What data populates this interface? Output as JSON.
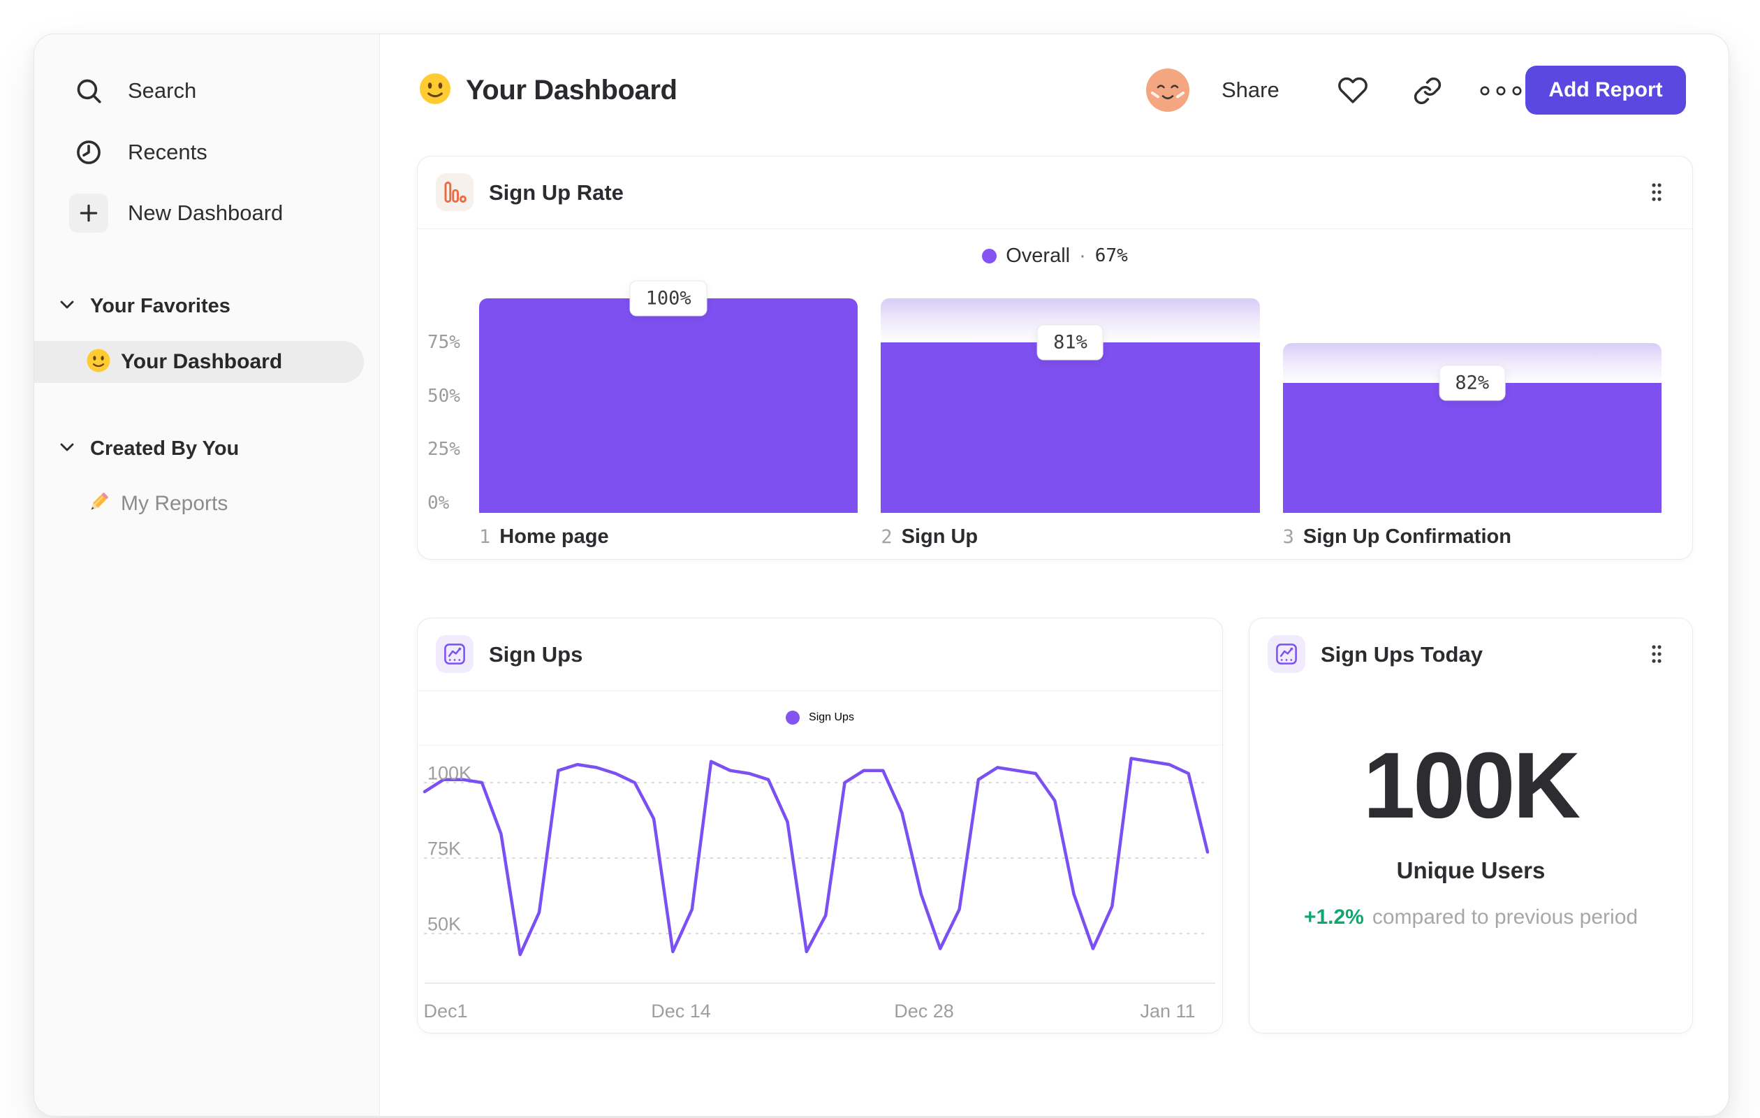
{
  "header": {
    "title": "Your Dashboard",
    "share_label": "Share",
    "add_report_label": "Add Report"
  },
  "sidebar": {
    "nav": [
      {
        "label": "Search",
        "icon": "search-icon"
      },
      {
        "label": "Recents",
        "icon": "clock-icon"
      },
      {
        "label": "New Dashboard",
        "icon": "plus-icon"
      }
    ],
    "sections": [
      {
        "title": "Your Favorites",
        "items": [
          {
            "label": "Your Dashboard",
            "icon": "smiley-emoji",
            "selected": true
          }
        ]
      },
      {
        "title": "Created By You",
        "items": [
          {
            "label": "My Reports",
            "icon": "pencil-emoji",
            "selected": false
          }
        ]
      }
    ]
  },
  "colors": {
    "accent_purple": "#7E50F0",
    "accent_indigo": "#5B48E0",
    "fade_gradient_top": "#D8CCF8",
    "positive_green": "#14A56F",
    "funnel_icon_orange": "#EE6A40",
    "sidebar_bg": "#FAFAFA"
  },
  "chart_data": [
    {
      "type": "bar",
      "subtype": "funnel-conversion",
      "title": "Sign Up Rate",
      "legend": {
        "series": "Overall",
        "separator": "·",
        "overall_value": "67%",
        "position": "top-center"
      },
      "ylim": [
        0,
        100
      ],
      "y_ticks": [
        "75%",
        "50%",
        "25%",
        "0%"
      ],
      "grid": false,
      "bar_color": "#7E50F0",
      "steps": [
        {
          "index": "1",
          "name": "Home page",
          "conversion_label": "100%",
          "bar_top_pct": 100,
          "solid_pct": 100
        },
        {
          "index": "2",
          "name": "Sign Up",
          "conversion_label": "81%",
          "bar_top_pct": 100,
          "solid_pct": 79.5
        },
        {
          "index": "3",
          "name": "Sign Up Confirmation",
          "conversion_label": "82%",
          "bar_top_pct": 79,
          "solid_pct": 60.5
        }
      ]
    },
    {
      "type": "line",
      "title": "Sign Ups",
      "legend": {
        "series": "Sign Ups",
        "position": "top-center"
      },
      "x_ticks": [
        "Dec1",
        "Dec 14",
        "Dec 28",
        "Jan 11"
      ],
      "y_ticks": [
        "100K",
        "75K",
        "50K"
      ],
      "unit": "K users",
      "grid": "dotted-horizontal",
      "line_color": "#7B50F2",
      "values_k": [
        97,
        101,
        101,
        100,
        83,
        43,
        57,
        104,
        106,
        105,
        103,
        100,
        88,
        44,
        58,
        107,
        104,
        103,
        101,
        87,
        44,
        56,
        100,
        104,
        104,
        90,
        63,
        45,
        58,
        101,
        105,
        104,
        103,
        94,
        63,
        45,
        59,
        108,
        107,
        106,
        103,
        77
      ]
    },
    {
      "type": "metric",
      "title": "Sign Ups Today",
      "value": "100K",
      "label": "Unique Users",
      "delta": "+1.2%",
      "delta_direction": "up",
      "delta_note": "compared to previous period"
    }
  ]
}
